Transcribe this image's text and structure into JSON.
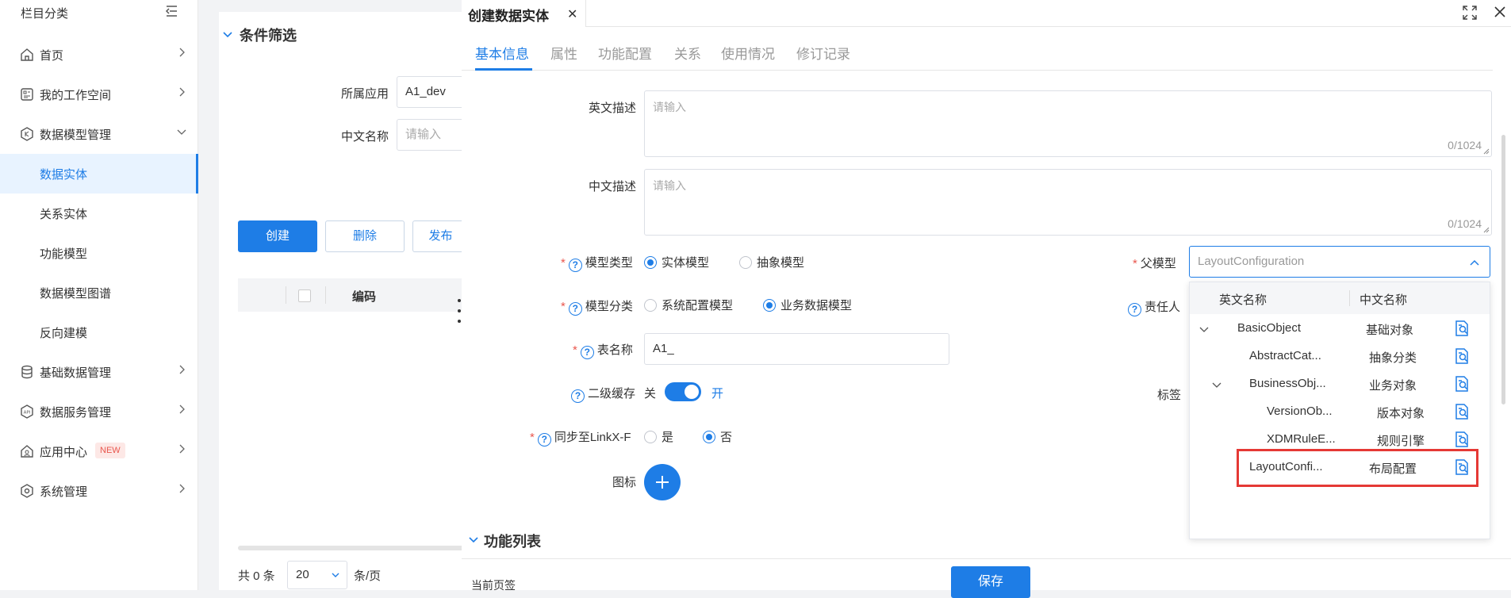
{
  "sidebar": {
    "title": "栏目分类",
    "items": [
      {
        "label": "首页",
        "icon": "home-icon"
      },
      {
        "label": "我的工作空间",
        "icon": "workspace-icon"
      },
      {
        "label": "数据模型管理",
        "icon": "model-icon"
      },
      {
        "label": "基础数据管理",
        "icon": "database-icon"
      },
      {
        "label": "数据服务管理",
        "icon": "api-icon"
      },
      {
        "label": "应用中心",
        "icon": "app-center-icon",
        "badge": "NEW"
      },
      {
        "label": "系统管理",
        "icon": "settings-icon"
      }
    ],
    "sub_items": [
      "数据实体",
      "关系实体",
      "功能模型",
      "数据模型图谱",
      "反向建模"
    ],
    "active_sub": "数据实体"
  },
  "list_page": {
    "filter_title": "条件筛选",
    "app_label": "所属应用",
    "app_value": "A1_dev",
    "cn_name_label": "中文名称",
    "cn_name_placeholder": "请输入",
    "buttons": {
      "create": "创建",
      "delete": "删除",
      "publish": "发布"
    },
    "table_column": "编码",
    "pager": {
      "total": "共 0 条",
      "page_size": "20",
      "unit": "条/页"
    }
  },
  "drawer": {
    "tab_title": "创建数据实体",
    "subtabs": [
      "基本信息",
      "属性",
      "功能配置",
      "关系",
      "使用情况",
      "修订记录"
    ],
    "active_subtab": "基本信息",
    "form": {
      "en_desc_label": "英文描述",
      "en_desc_placeholder": "请输入",
      "en_desc_count": "0/1024",
      "cn_desc_label": "中文描述",
      "cn_desc_placeholder": "请输入",
      "cn_desc_count": "0/1024",
      "model_type_label": "模型类型",
      "model_type_options": [
        "实体模型",
        "抽象模型"
      ],
      "model_type_selected": "实体模型",
      "model_class_label": "模型分类",
      "model_class_options": [
        "系统配置模型",
        "业务数据模型"
      ],
      "model_class_selected": "业务数据模型",
      "table_name_label": "表名称",
      "table_name_value": "A1_",
      "cache_label": "二级缓存",
      "cache_off": "关",
      "cache_on": "开",
      "cache_enabled": true,
      "sync_label": "同步至LinkX-F",
      "sync_options": [
        "是",
        "否"
      ],
      "sync_selected": "否",
      "icon_label": "图标",
      "parent_label": "父模型",
      "parent_placeholder": "LayoutConfiguration",
      "owner_label": "责任人",
      "tag_label": "标签"
    },
    "parent_dropdown": {
      "col_en": "英文名称",
      "col_cn": "中文名称",
      "rows": [
        {
          "en": "BasicObject",
          "cn": "基础对象",
          "expanded": true
        },
        {
          "en": "AbstractCat...",
          "cn": "抽象分类"
        },
        {
          "en": "BusinessObj...",
          "cn": "业务对象",
          "expanded": true
        },
        {
          "en": "VersionOb...",
          "cn": "版本对象"
        },
        {
          "en": "XDMRuleE...",
          "cn": "规则引擎"
        },
        {
          "en": "LayoutConfi...",
          "cn": "布局配置",
          "highlighted": true
        }
      ]
    },
    "section_function_list": "功能列表",
    "footer_text": "当前页签",
    "save_label": "保存"
  },
  "colors": {
    "primary": "#1e7de6",
    "required": "#e9574e",
    "highlight": "#e53935",
    "active_bg": "#e8f3ff"
  }
}
